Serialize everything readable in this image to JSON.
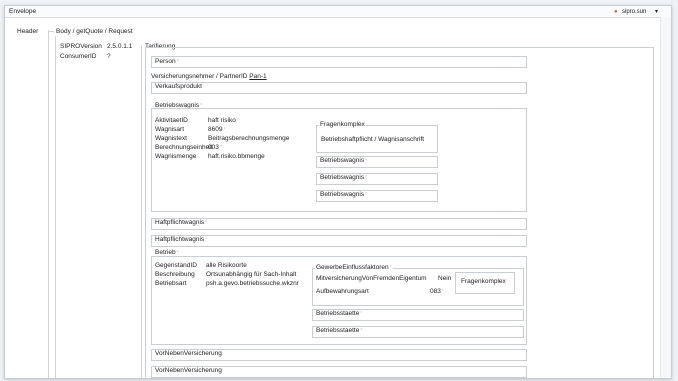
{
  "tree": {
    "envelope": "Envelope",
    "header": "Header",
    "body": "Body / getQuote / Request"
  },
  "user_menu": {
    "name": "sipro.sun",
    "caret": "▾"
  },
  "header_fields": [
    {
      "label": "SIPROVersion",
      "value": "2.5.0.1.1"
    },
    {
      "label": "ConsumerID",
      "value": "?"
    }
  ],
  "tarifierung": {
    "title": "Tarifierung",
    "person": "Person",
    "vn_label": "Versicherungsnehmer / PartnerID",
    "vn_link": "Pan-1",
    "verkaufsprodukt": "Verkaufsprodukt",
    "betriebswagnis": {
      "title": "Betriebswagnis",
      "rows": [
        {
          "label": "AktivitaetID",
          "value": "haft risiko"
        },
        {
          "label": "Wagnisart",
          "value": "8609"
        },
        {
          "label": "Wagnistext",
          "value": "Beitragsberechnungsmenge"
        },
        {
          "label": "Berechnungseinheit",
          "value": "003"
        },
        {
          "label": "Wagnismenge",
          "value": "haft.risiko.bbmenge"
        }
      ],
      "fragenkomplex_title": "Fragenkomplex",
      "fragenkomplex_item": "Betriebshaftpflicht / Wagnisanschrift",
      "sub_items": [
        "Betriebswagnis",
        "Betriebswagnis",
        "Betriebswagnis"
      ]
    },
    "haftpflichtwagnis": [
      "Haftpflichtwagnis",
      "Haftpflichtwagnis"
    ],
    "betrieb": {
      "title": "Betrieb",
      "rows": [
        {
          "label": "GegenstandID",
          "value": "alle Risikoorte"
        },
        {
          "label": "Beschreibung",
          "value": "Ortsunabhängig für Sach-Inhalt"
        },
        {
          "label": "Betriebsart",
          "value": "psh.a.gevo.betriebssuche.wkznr"
        }
      ],
      "gewerbe_title": "GewerbeEinflussfaktoren",
      "gewerbe_rows": [
        {
          "label": "MitversicherungVonFremdenEigentum",
          "value": "Nein"
        },
        {
          "label": "Aufbewahrungsart",
          "value": "083"
        }
      ],
      "fragenkomplex": "Fragenkomplex",
      "betriebsstaette": [
        "Betriebsstaette",
        "Betriebsstaette"
      ]
    },
    "vorneben": [
      "VorNebenVersicherung",
      "VorNebenVersicherung"
    ]
  }
}
